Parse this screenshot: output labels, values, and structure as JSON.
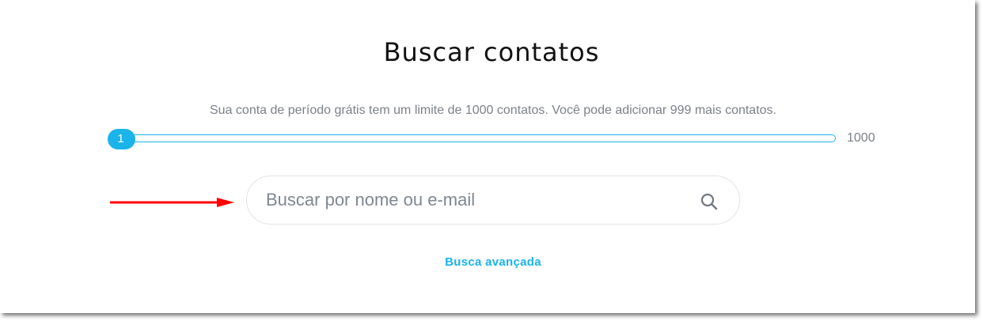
{
  "title": "Buscar contatos",
  "limit_message": "Sua conta de período grátis tem um limite de 1000 contatos. Você pode adicionar 999 mais contatos.",
  "slider": {
    "current_label": "1",
    "max_label": "1000",
    "current": 1,
    "max": 1000,
    "accent_color": "#1ab3ea"
  },
  "search": {
    "placeholder": "Buscar por nome ou e-mail",
    "value": "",
    "icon": "search-icon"
  },
  "advanced_search_label": "Busca avançada",
  "annotation": {
    "icon": "red-arrow-icon",
    "color": "#ff0000"
  }
}
